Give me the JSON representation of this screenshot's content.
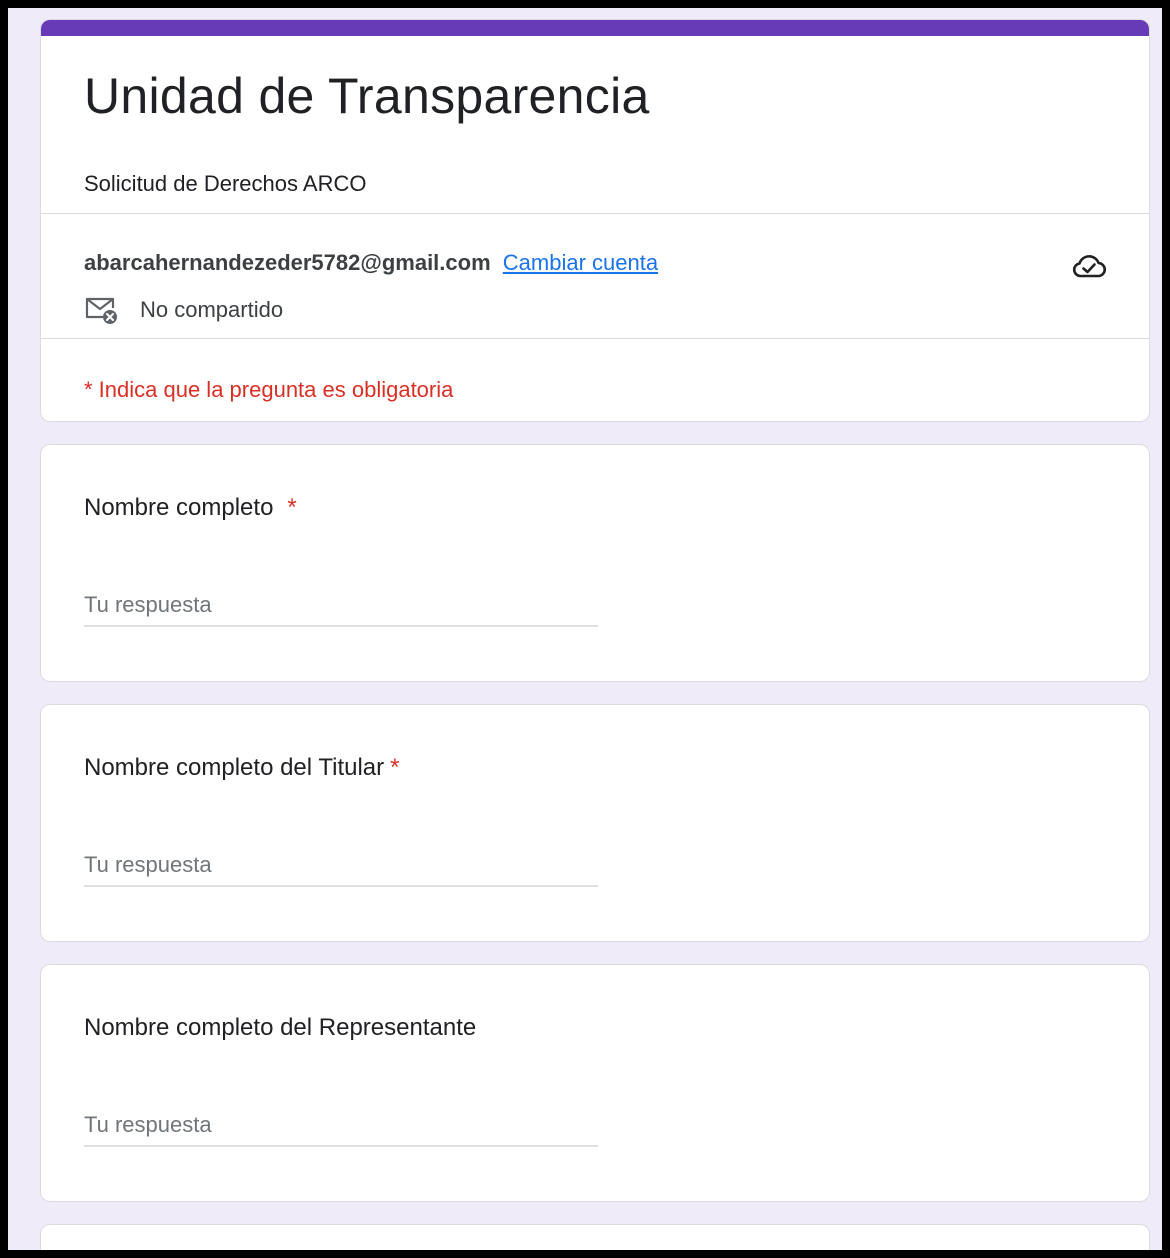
{
  "form": {
    "title": "Unidad de Transparencia",
    "description": "Solicitud de Derechos ARCO",
    "accent_color": "#673ab7"
  },
  "account": {
    "email": "abarcahernandezeder5782@gmail.com",
    "switch_label": "Cambiar cuenta",
    "shared_status": "No compartido",
    "save_status_icon": "cloud-check-icon",
    "shared_icon": "mail-off-icon"
  },
  "required_note": "* Indica que la pregunta es obligatoria",
  "questions": [
    {
      "label": "Nombre completo",
      "required_mark": "*",
      "placeholder": "Tu respuesta"
    },
    {
      "label": "Nombre completo del Titular",
      "required_mark": "*",
      "placeholder": "Tu respuesta"
    },
    {
      "label": "Nombre completo del Representante",
      "required_mark": "",
      "placeholder": "Tu respuesta"
    }
  ]
}
